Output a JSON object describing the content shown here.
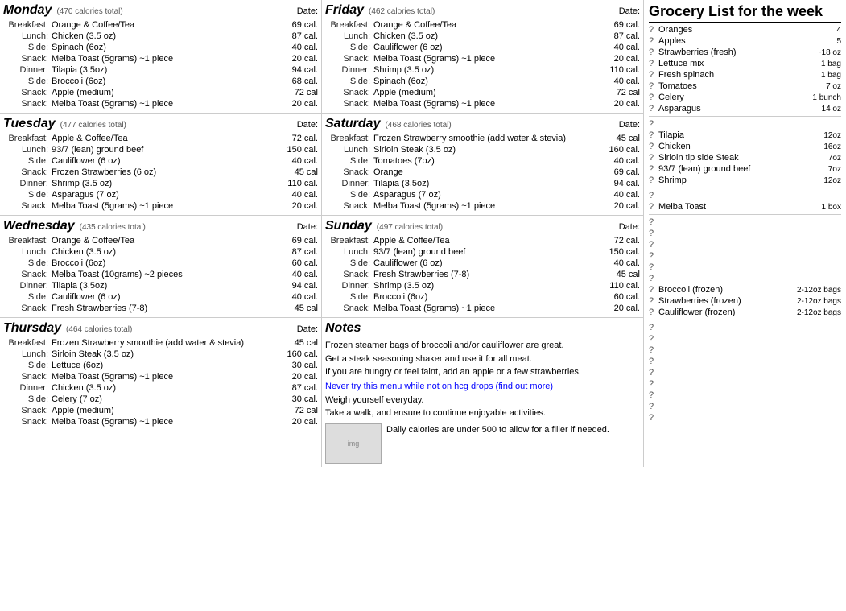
{
  "monday": {
    "title": "Monday",
    "calories": "(470 calories total)",
    "date_label": "Date:",
    "meals": [
      {
        "label": "Breakfast:",
        "desc": "Orange & Coffee/Tea",
        "cal": "69 cal."
      },
      {
        "label": "Lunch:",
        "desc": "Chicken (3.5 oz)",
        "cal": "87 cal."
      },
      {
        "label": "Side:",
        "desc": "Spinach (6oz)",
        "cal": "40 cal."
      },
      {
        "label": "Snack:",
        "desc": "Melba Toast (5grams) ~1 piece",
        "cal": "20 cal."
      },
      {
        "label": "Dinner:",
        "desc": "Tilapia (3.5oz)",
        "cal": "94 cal."
      },
      {
        "label": "Side:",
        "desc": "Broccoli (6oz)",
        "cal": "68 cal."
      },
      {
        "label": "Snack:",
        "desc": "Apple (medium)",
        "cal": "72 cal"
      },
      {
        "label": "Snack:",
        "desc": "Melba Toast (5grams) ~1 piece",
        "cal": "20 cal."
      }
    ]
  },
  "tuesday": {
    "title": "Tuesday",
    "calories": "(477 calories total)",
    "date_label": "Date:",
    "meals": [
      {
        "label": "Breakfast:",
        "desc": "Apple & Coffee/Tea",
        "cal": "72 cal."
      },
      {
        "label": "Lunch:",
        "desc": "93/7 (lean) ground beef",
        "cal": "150 cal."
      },
      {
        "label": "Side:",
        "desc": "Cauliflower (6 oz)",
        "cal": "40 cal."
      },
      {
        "label": "Snack:",
        "desc": "Frozen Strawberries (6 oz)",
        "cal": "45 cal"
      },
      {
        "label": "Dinner:",
        "desc": "Shrimp (3.5 oz)",
        "cal": "110 cal."
      },
      {
        "label": "Side:",
        "desc": "Asparagus (7 oz)",
        "cal": "40 cal."
      },
      {
        "label": "Snack:",
        "desc": "Melba Toast (5grams) ~1 piece",
        "cal": "20 cal."
      }
    ]
  },
  "wednesday": {
    "title": "Wednesday",
    "calories": "(435 calories total)",
    "date_label": "Date:",
    "meals": [
      {
        "label": "Breakfast:",
        "desc": "Orange & Coffee/Tea",
        "cal": "69 cal."
      },
      {
        "label": "Lunch:",
        "desc": "Chicken (3.5 oz)",
        "cal": "87 cal."
      },
      {
        "label": "Side:",
        "desc": "Broccoli (6oz)",
        "cal": "60 cal."
      },
      {
        "label": "Snack:",
        "desc": "Melba Toast (10grams) ~2 pieces",
        "cal": "40 cal."
      },
      {
        "label": "Dinner:",
        "desc": "Tilapia (3.5oz)",
        "cal": "94 cal."
      },
      {
        "label": "Side:",
        "desc": "Cauliflower (6 oz)",
        "cal": "40 cal."
      },
      {
        "label": "Snack:",
        "desc": "Fresh Strawberries (7-8)",
        "cal": "45 cal"
      }
    ]
  },
  "thursday": {
    "title": "Thursday",
    "calories": "(464 calories total)",
    "date_label": "Date:",
    "meals": [
      {
        "label": "Breakfast:",
        "desc": "Frozen Strawberry smoothie (add water & stevia)",
        "cal": "45 cal"
      },
      {
        "label": "Lunch:",
        "desc": "Sirloin Steak (3.5 oz)",
        "cal": "160 cal."
      },
      {
        "label": "Side:",
        "desc": "Lettuce (6oz)",
        "cal": "30 cal."
      },
      {
        "label": "Snack:",
        "desc": "Melba Toast (5grams) ~1 piece",
        "cal": "20 cal."
      },
      {
        "label": "Dinner:",
        "desc": "Chicken (3.5 oz)",
        "cal": "87 cal."
      },
      {
        "label": "Side:",
        "desc": "Celery (7 oz)",
        "cal": "30 cal."
      },
      {
        "label": "Snack:",
        "desc": "Apple (medium)",
        "cal": "72 cal"
      },
      {
        "label": "Snack:",
        "desc": "Melba Toast (5grams) ~1 piece",
        "cal": "20 cal."
      }
    ]
  },
  "friday": {
    "title": "Friday",
    "calories": "(462 calories total)",
    "date_label": "Date:",
    "meals": [
      {
        "label": "Breakfast:",
        "desc": "Orange & Coffee/Tea",
        "cal": "69 cal."
      },
      {
        "label": "Lunch:",
        "desc": "Chicken (3.5 oz)",
        "cal": "87 cal."
      },
      {
        "label": "Side:",
        "desc": "Cauliflower (6 oz)",
        "cal": "40 cal."
      },
      {
        "label": "Snack:",
        "desc": "Melba Toast (5grams) ~1 piece",
        "cal": "20 cal."
      },
      {
        "label": "Dinner:",
        "desc": "Shrimp (3.5 oz)",
        "cal": "110 cal."
      },
      {
        "label": "Side:",
        "desc": "Spinach (6oz)",
        "cal": "40 cal."
      },
      {
        "label": "Snack:",
        "desc": "Apple (medium)",
        "cal": "72 cal"
      },
      {
        "label": "Snack:",
        "desc": "Melba Toast (5grams) ~1 piece",
        "cal": "20 cal."
      }
    ]
  },
  "saturday": {
    "title": "Saturday",
    "calories": "(468 calories total)",
    "date_label": "Date:",
    "meals": [
      {
        "label": "Breakfast:",
        "desc": "Frozen Strawberry smoothie (add water & stevia)",
        "cal": "45 cal"
      },
      {
        "label": "Lunch:",
        "desc": "Sirloin Steak (3.5 oz)",
        "cal": "160 cal."
      },
      {
        "label": "Side:",
        "desc": "Tomatoes (7oz)",
        "cal": "40 cal."
      },
      {
        "label": "Snack:",
        "desc": "Orange",
        "cal": "69 cal."
      },
      {
        "label": "Dinner:",
        "desc": "Tilapia (3.5oz)",
        "cal": "94 cal."
      },
      {
        "label": "Side:",
        "desc": "Asparagus (7 oz)",
        "cal": "40 cal."
      },
      {
        "label": "Snack:",
        "desc": "Melba Toast (5grams) ~1 piece",
        "cal": "20 cal."
      }
    ]
  },
  "sunday": {
    "title": "Sunday",
    "calories": "(497 calories total)",
    "date_label": "Date:",
    "meals": [
      {
        "label": "Breakfast:",
        "desc": "Apple & Coffee/Tea",
        "cal": "72 cal."
      },
      {
        "label": "Lunch:",
        "desc": "93/7 (lean) ground beef",
        "cal": "150 cal."
      },
      {
        "label": "Side:",
        "desc": "Cauliflower (6 oz)",
        "cal": "40 cal."
      },
      {
        "label": "Snack:",
        "desc": "Fresh Strawberries (7-8)",
        "cal": "45 cal"
      },
      {
        "label": "Dinner:",
        "desc": "Shrimp (3.5 oz)",
        "cal": "110 cal."
      },
      {
        "label": "Side:",
        "desc": "Broccoli (6oz)",
        "cal": "60 cal."
      },
      {
        "label": "Snack:",
        "desc": "Melba Toast (5grams) ~1 piece",
        "cal": "20 cal."
      }
    ]
  },
  "notes": {
    "title": "Notes",
    "lines": [
      "Frozen steamer bags of broccoli and/or cauliflower are great.",
      "Get a steak seasoning shaker and use it for all meat.",
      "If you are hungry or feel faint, add an apple or a few strawberries."
    ],
    "link": "Never try this menu while not on hcg drops (find out more)",
    "extra_lines": [
      "Weigh yourself everyday.",
      "Take a walk, and ensure to continue enjoyable activities."
    ],
    "footer_text": "Daily calories are under 500 to allow for a filler if needed."
  },
  "grocery": {
    "title": "Grocery List for the week",
    "items": [
      {
        "q": "?",
        "item": "Oranges",
        "qty": "4"
      },
      {
        "q": "?",
        "item": "Apples",
        "qty": "5"
      },
      {
        "q": "?",
        "item": "Strawberries (fresh)",
        "qty": "~18 oz"
      },
      {
        "q": "?",
        "item": "Lettuce mix",
        "qty": "1 bag"
      },
      {
        "q": "?",
        "item": "Fresh spinach",
        "qty": "1 bag"
      },
      {
        "q": "?",
        "item": "Tomatoes",
        "qty": "7 oz"
      },
      {
        "q": "?",
        "item": "Celery",
        "qty": "1 bunch"
      },
      {
        "q": "?",
        "item": "Asparagus",
        "qty": "14 oz"
      },
      {
        "q": "?",
        "item": "",
        "qty": ""
      },
      {
        "q": "?",
        "item": "Tilapia",
        "qty": "12oz"
      },
      {
        "q": "?",
        "item": "Chicken",
        "qty": "16oz"
      },
      {
        "q": "?",
        "item": "Sirloin tip side Steak",
        "qty": "7oz"
      },
      {
        "q": "?",
        "item": "93/7 (lean) ground beef",
        "qty": "7oz"
      },
      {
        "q": "?",
        "item": "Shrimp",
        "qty": "12oz"
      },
      {
        "q": "?",
        "item": "",
        "qty": ""
      },
      {
        "q": "?",
        "item": "Melba Toast",
        "qty": "1 box"
      },
      {
        "q": "?",
        "item": "",
        "qty": ""
      },
      {
        "q": "?",
        "item": "",
        "qty": ""
      },
      {
        "q": "?",
        "item": "",
        "qty": ""
      },
      {
        "q": "?",
        "item": "",
        "qty": ""
      },
      {
        "q": "?",
        "item": "",
        "qty": ""
      },
      {
        "q": "?",
        "item": "",
        "qty": ""
      },
      {
        "q": "?",
        "item": "Broccoli (frozen)",
        "qty": "2-12oz bags"
      },
      {
        "q": "?",
        "item": "Strawberries (frozen)",
        "qty": "2-12oz bags"
      },
      {
        "q": "?",
        "item": "Cauliflower (frozen)",
        "qty": "2-12oz bags"
      },
      {
        "q": "?",
        "item": "",
        "qty": ""
      },
      {
        "q": "?",
        "item": "",
        "qty": ""
      },
      {
        "q": "?",
        "item": "",
        "qty": ""
      },
      {
        "q": "?",
        "item": "",
        "qty": ""
      },
      {
        "q": "?",
        "item": "",
        "qty": ""
      },
      {
        "q": "?",
        "item": "",
        "qty": ""
      },
      {
        "q": "?",
        "item": "",
        "qty": ""
      },
      {
        "q": "?",
        "item": "",
        "qty": ""
      },
      {
        "q": "?",
        "item": "",
        "qty": ""
      }
    ]
  }
}
